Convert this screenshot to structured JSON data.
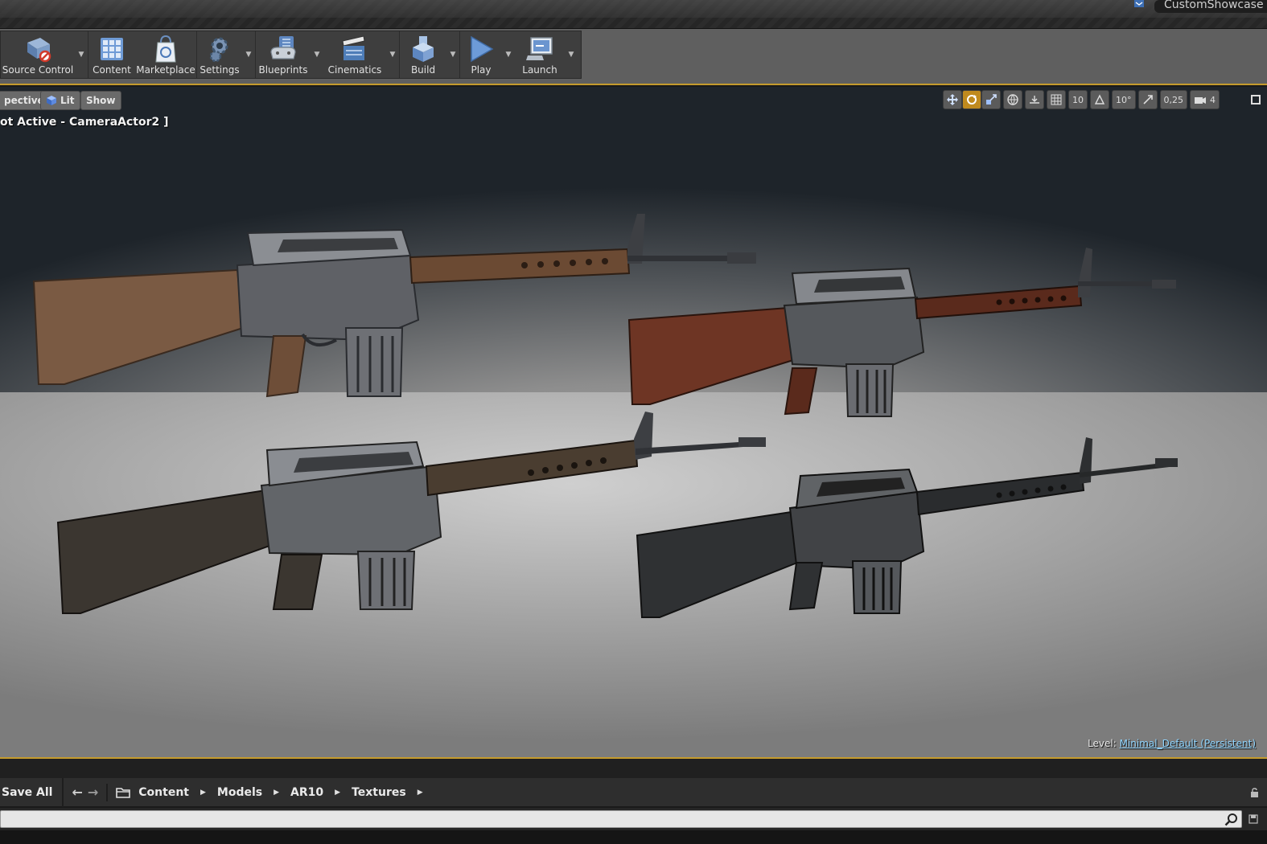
{
  "titlebar": {
    "project_tab": "CustomShowcase"
  },
  "toolbar": {
    "buttons": [
      {
        "label": "Source Control",
        "icon": "source-control-icon"
      },
      {
        "label": "Content",
        "icon": "content-icon"
      },
      {
        "label": "Marketplace",
        "icon": "marketplace-icon"
      },
      {
        "label": "Settings",
        "icon": "settings-icon"
      },
      {
        "label": "Blueprints",
        "icon": "blueprints-icon"
      },
      {
        "label": "Cinematics",
        "icon": "cinematics-icon"
      },
      {
        "label": "Build",
        "icon": "build-icon"
      },
      {
        "label": "Play",
        "icon": "play-icon"
      },
      {
        "label": "Launch",
        "icon": "launch-icon"
      }
    ],
    "accent_color": "#c59b2d"
  },
  "viewport": {
    "view_mode": "pective",
    "lit_label": "Lit",
    "show_label": "Show",
    "camera_label": "ot Active - CameraActor2 ]",
    "grid_snap": "10",
    "rotation_snap": "10°",
    "scale_snap": "0,25",
    "camera_speed": "4",
    "level_prefix": "Level:",
    "level_name": "Minimal_Default (Persistent)",
    "rifles": [
      {
        "name": "rifle-brown",
        "stock_color": "#7a5a43",
        "handguard_color": "#6b4a33"
      },
      {
        "name": "rifle-red-wood",
        "stock_color": "#6e3524",
        "handguard_color": "#5a2a1c"
      },
      {
        "name": "rifle-dark-wood",
        "stock_color": "#3b3630",
        "handguard_color": "#4a3d30"
      },
      {
        "name": "rifle-black",
        "stock_color": "#2f3133",
        "handguard_color": "#2a2c2e"
      }
    ]
  },
  "content_browser": {
    "save_all": "Save All",
    "breadcrumbs": [
      "Content",
      "Models",
      "AR10",
      "Textures"
    ],
    "search_placeholder": ""
  }
}
